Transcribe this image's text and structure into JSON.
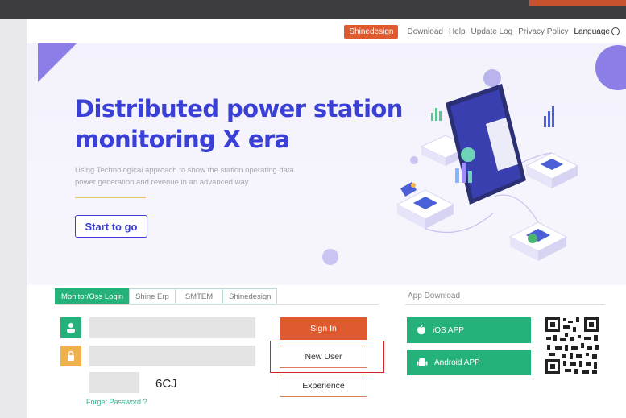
{
  "header": {
    "brand_label": "Shinedesign",
    "nav": [
      "Download",
      "Help",
      "Update Log",
      "Privacy Policy"
    ],
    "language_label": "Language"
  },
  "hero": {
    "title_line1": "Distributed power station",
    "title_line2": "monitoring X era",
    "desc_line1": "Using Technological approach to show the station operating data",
    "desc_line2": "power generation and revenue in an advanced way",
    "start_label": "Start to go"
  },
  "login": {
    "tabs": [
      "Monitor/Oss Login",
      "Shine Erp",
      "SMTEM",
      "Shinedesign"
    ],
    "active_tab": 0,
    "username": "",
    "password": "",
    "captcha_input": "",
    "captcha_code": "6CJ",
    "forgot_label": "Forget Password ?",
    "signin_label": "Sign In",
    "newuser_label": "New User",
    "experience_label": "Experience"
  },
  "app_download": {
    "title": "App Download",
    "ios_label": "iOS APP",
    "android_label": "Android APP"
  },
  "colors": {
    "brand_orange": "#e05a2f",
    "accent_green": "#24b27a",
    "title_blue": "#3a3fd6",
    "highlight_red": "#d6242b"
  }
}
